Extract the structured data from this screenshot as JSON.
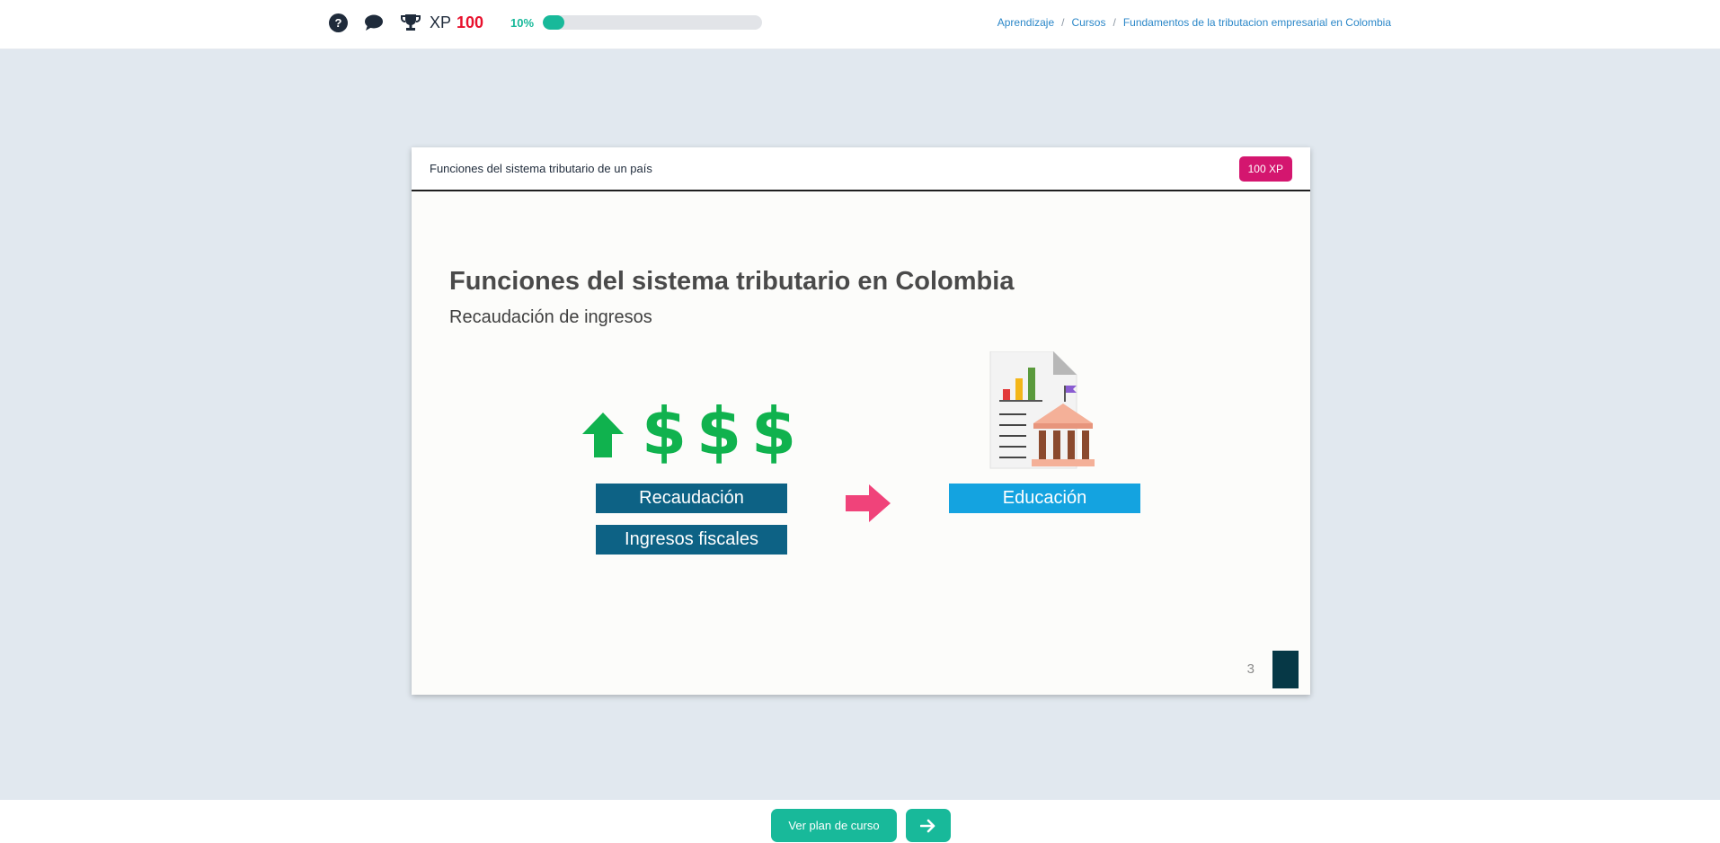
{
  "topbar": {
    "help_icon_glyph": "?",
    "xp_label": "XP",
    "xp_value": "100",
    "progress_label": "10%",
    "progress_fraction": 0.1,
    "breadcrumb": [
      "Aprendizaje",
      "Cursos",
      "Fundamentos de la tributacion empresarial en Colombia"
    ],
    "breadcrumb_separator": "/"
  },
  "card": {
    "title": "Funciones del sistema tributario de un país",
    "xp_badge": "100 XP",
    "slide": {
      "title": "Funciones del sistema tributario en Colombia",
      "subtitle": "Recaudación de ingresos",
      "dollar_sign": "$",
      "box_recaudacion": "Recaudación",
      "box_ingresos": "Ingresos fiscales",
      "box_educacion": "Educación",
      "page_number": "3"
    }
  },
  "bottombar": {
    "plan_button": "Ver plan de curso",
    "next_button_icon": "arrow-right-icon"
  },
  "colors": {
    "accent": "#18b99a",
    "xp_red": "#e8112d",
    "badge_pink": "#d4166f",
    "dollar_green": "#10b24e",
    "box_dark_blue": "#0d6285",
    "box_light_blue": "#14a3e0",
    "arrow_pink": "#f0437a"
  }
}
